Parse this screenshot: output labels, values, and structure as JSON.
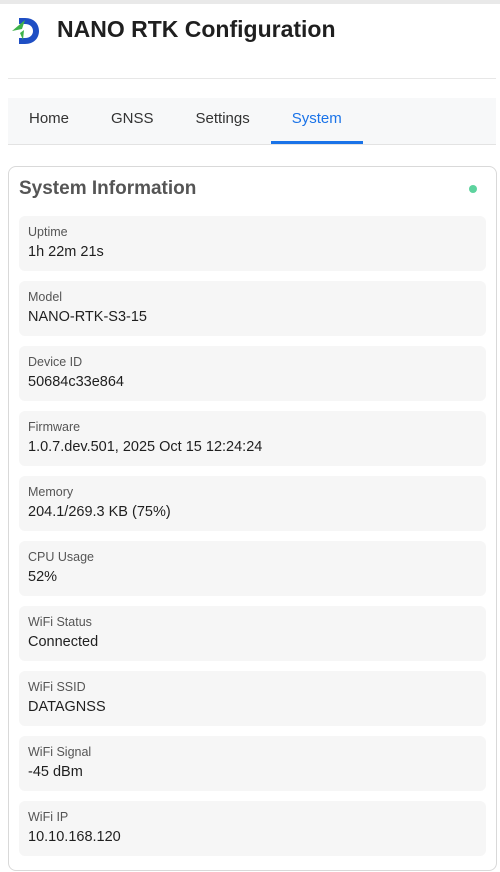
{
  "header": {
    "logo_icon": "datagnss-d-logo-icon",
    "title": "NANO RTK Configuration"
  },
  "tabs": [
    {
      "label": "Home",
      "active": false
    },
    {
      "label": "GNSS",
      "active": false
    },
    {
      "label": "Settings",
      "active": false
    },
    {
      "label": "System",
      "active": true
    }
  ],
  "colors": {
    "accent": "#1a73e8",
    "status_online": "#5dd39e",
    "logo_blue": "#1f4fc4",
    "logo_green": "#3fb24a"
  },
  "system_info": {
    "title": "System Information",
    "status_indicator": "online",
    "items": [
      {
        "label": "Uptime",
        "value": "1h 22m 21s"
      },
      {
        "label": "Model",
        "value": "NANO-RTK-S3-15"
      },
      {
        "label": "Device ID",
        "value": "50684c33e864"
      },
      {
        "label": "Firmware",
        "value": "1.0.7.dev.501, 2025 Oct 15 12:24:24"
      },
      {
        "label": "Memory",
        "value": "204.1/269.3 KB (75%)"
      },
      {
        "label": "CPU Usage",
        "value": "52%"
      },
      {
        "label": "WiFi Status",
        "value": "Connected"
      },
      {
        "label": "WiFi SSID",
        "value": "DATAGNSS"
      },
      {
        "label": "WiFi Signal",
        "value": "-45 dBm"
      },
      {
        "label": "WiFi IP",
        "value": "10.10.168.120"
      }
    ]
  }
}
